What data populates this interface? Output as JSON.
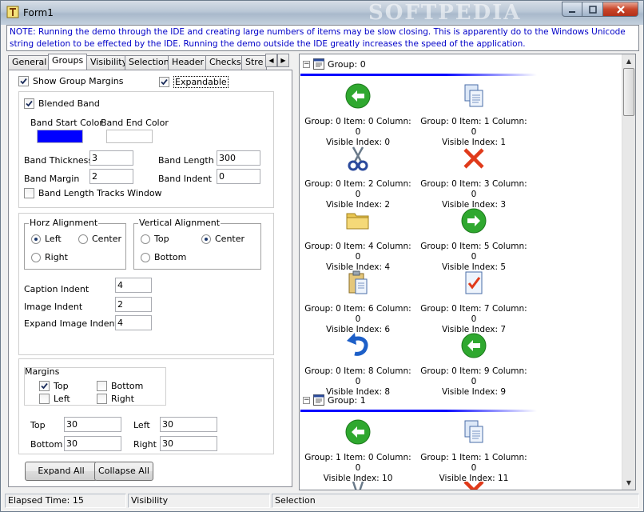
{
  "window": {
    "title": "Form1",
    "watermark": "SOFTPEDIA"
  },
  "note": "NOTE:  Running the demo through the IDE and creating large numbers of items may be slow closing.  This is apparently do to the Windows Unicode string deletion to be effected by the IDE.  Running the demo outside the IDE greatly increases the speed of the application.",
  "tabs": [
    {
      "label": "General"
    },
    {
      "label": "Groups"
    },
    {
      "label": "Visibility"
    },
    {
      "label": "Selection"
    },
    {
      "label": "Header"
    },
    {
      "label": "Checks"
    },
    {
      "label": "Stre"
    }
  ],
  "groups_tab": {
    "show_group_margins": {
      "label": "Show Group Margins",
      "checked": true
    },
    "expandable": {
      "label": "Expandable",
      "checked": true
    },
    "blended_band": {
      "label": "Blended Band",
      "checked": true
    },
    "band_start_color_label": "Band Start Color",
    "band_end_color_label": "Band End Color",
    "band_start_color": "#0000ff",
    "band_end_color": "#ffffff",
    "band_thickness": {
      "label": "Band Thickness",
      "value": "3"
    },
    "band_length": {
      "label": "Band Length",
      "value": "300"
    },
    "band_margin": {
      "label": "Band Margin",
      "value": "2"
    },
    "band_indent": {
      "label": "Band Indent",
      "value": "0"
    },
    "band_length_tracks_window": {
      "label": "Band Length Tracks Window",
      "checked": false
    },
    "horz_alignment": {
      "title": "Horz Alignment",
      "left": "Left",
      "center": "Center",
      "right": "Right",
      "selected": "Left"
    },
    "vertical_alignment": {
      "title": "Vertical Alignment",
      "top": "Top",
      "center": "Center",
      "bottom": "Bottom",
      "selected": "Center"
    },
    "caption_indent": {
      "label": "Caption Indent",
      "value": "4"
    },
    "image_indent": {
      "label": "Image Indent",
      "value": "2"
    },
    "expand_image_indent": {
      "label": "Expand Image Indent",
      "value": "4"
    },
    "margins": {
      "title": "Margins",
      "top": {
        "label": "Top",
        "checked": true
      },
      "bottom": {
        "label": "Bottom",
        "checked": false
      },
      "left": {
        "label": "Left",
        "checked": false
      },
      "right": {
        "label": "Right",
        "checked": false
      }
    },
    "margin_values": {
      "top": {
        "label": "Top",
        "value": "30"
      },
      "left": {
        "label": "Left",
        "value": "30"
      },
      "bottom": {
        "label": "Bottom",
        "value": "30"
      },
      "right": {
        "label": "Right",
        "value": "30"
      }
    },
    "expand_all": "Expand All",
    "collapse_all": "Collapse All"
  },
  "listview": {
    "groups": [
      {
        "label": "Group: 0",
        "expander": "−"
      },
      {
        "label": "Group: 1",
        "expander": "−"
      }
    ],
    "items": [
      {
        "line1": "Group: 0 Item: 0 Column: 0",
        "line2": "Visible Index: 0",
        "icon": "arrow-left-icon"
      },
      {
        "line1": "Group: 0 Item: 1 Column: 0",
        "line2": "Visible Index: 1",
        "icon": "copy-icon"
      },
      {
        "line1": "Group: 0 Item: 2 Column: 0",
        "line2": "Visible Index: 2",
        "icon": "scissors-icon"
      },
      {
        "line1": "Group: 0 Item: 3 Column: 0",
        "line2": "Visible Index: 3",
        "icon": "delete-x-icon"
      },
      {
        "line1": "Group: 0 Item: 4 Column: 0",
        "line2": "Visible Index: 4",
        "icon": "folder-icon"
      },
      {
        "line1": "Group: 0 Item: 5 Column: 0",
        "line2": "Visible Index: 5",
        "icon": "arrow-right-icon"
      },
      {
        "line1": "Group: 0 Item: 6 Column: 0",
        "line2": "Visible Index: 6",
        "icon": "clipboard-icon"
      },
      {
        "line1": "Group: 0 Item: 7 Column: 0",
        "line2": "Visible Index: 7",
        "icon": "checklist-icon"
      },
      {
        "line1": "Group: 0 Item: 8 Column: 0",
        "line2": "Visible Index: 8",
        "icon": "undo-icon"
      },
      {
        "line1": "Group: 0 Item: 9 Column: 0",
        "line2": "Visible Index: 9",
        "icon": "arrow-left-icon"
      },
      {
        "line1": "Group: 1 Item: 0 Column: 0",
        "line2": "Visible Index: 10",
        "icon": "arrow-left-icon"
      },
      {
        "line1": "Group: 1 Item: 1 Column: 0",
        "line2": "Visible Index: 11",
        "icon": "copy-icon"
      }
    ]
  },
  "statusbar": {
    "elapsed": "Elapsed Time: 15",
    "visibility": "Visibility",
    "selection": "Selection"
  },
  "colors": {
    "band": "#0000ff",
    "note_text": "#0000c8",
    "accent_green": "#2fa82f",
    "accent_red": "#e03a1a",
    "accent_blue": "#1d5fc8"
  }
}
